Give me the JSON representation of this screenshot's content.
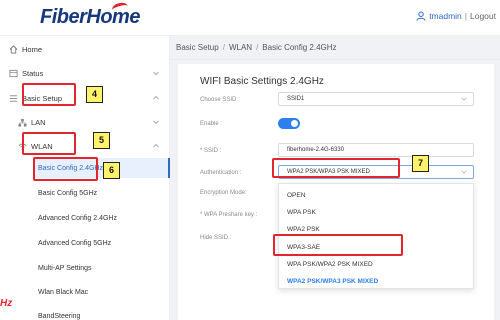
{
  "header": {
    "brand": "FiberHome",
    "user": "tmadmin",
    "separator": "|",
    "logout": "Logout"
  },
  "sidebar": {
    "home": "Home",
    "status": "Status",
    "basic_setup": "Basic Setup",
    "lan": "LAN",
    "wlan": "WLAN",
    "sub_items": [
      "Basic Config 2.4GHz",
      "Basic Config 5GHz",
      "Advanced Config 2.4GHz",
      "Advanced Config 5GHz",
      "Multi-AP Settings",
      "Wlan Black Mac",
      "BandSteering"
    ],
    "active_sub_item": "Basic Config 2.4GHz"
  },
  "breadcrumb": {
    "items": [
      "Basic Setup",
      "WLAN",
      "Basic Config 2.4GHz"
    ],
    "separator": "/"
  },
  "page": {
    "title": "WIFI Basic Settings 2.4GHz",
    "fields": {
      "choose_ssid_label": "Choose SSID :",
      "choose_ssid_value": "SSID1",
      "enable_label": "Enable :",
      "enable_value": true,
      "ssid_label": "* SSID :",
      "ssid_value": "fiberhome-2.4G-6330",
      "auth_label": "Authentication :",
      "auth_value": "WPA2 PSK/WPA3 PSK MIXED",
      "encryption_label": "Encryption Mode:",
      "preshare_label": "* WPA Preshare key :",
      "hide_ssid_label": "Hide SSID :"
    },
    "auth_options": [
      "OPEN",
      "WPA PSK",
      "WPA2 PSK",
      "WPA3-SAE",
      "WPA PSK/WPA2 PSK MIXED",
      "WPA2 PSK/WPA3 PSK MIXED"
    ],
    "auth_selected_option": "WPA2 PSK/WPA3 PSK MIXED"
  },
  "annotations": {
    "step4": "4",
    "step5": "5",
    "step6": "6",
    "step7": "7",
    "cut_text": "Hz",
    "highlight_color": "#e3262d",
    "tag_color": "#fff36b"
  },
  "colors": {
    "brand_blue": "#17387e",
    "accent_blue": "#2d7ff0",
    "link_blue": "#2d6bc4",
    "bg_grey": "#f0f2f5"
  }
}
